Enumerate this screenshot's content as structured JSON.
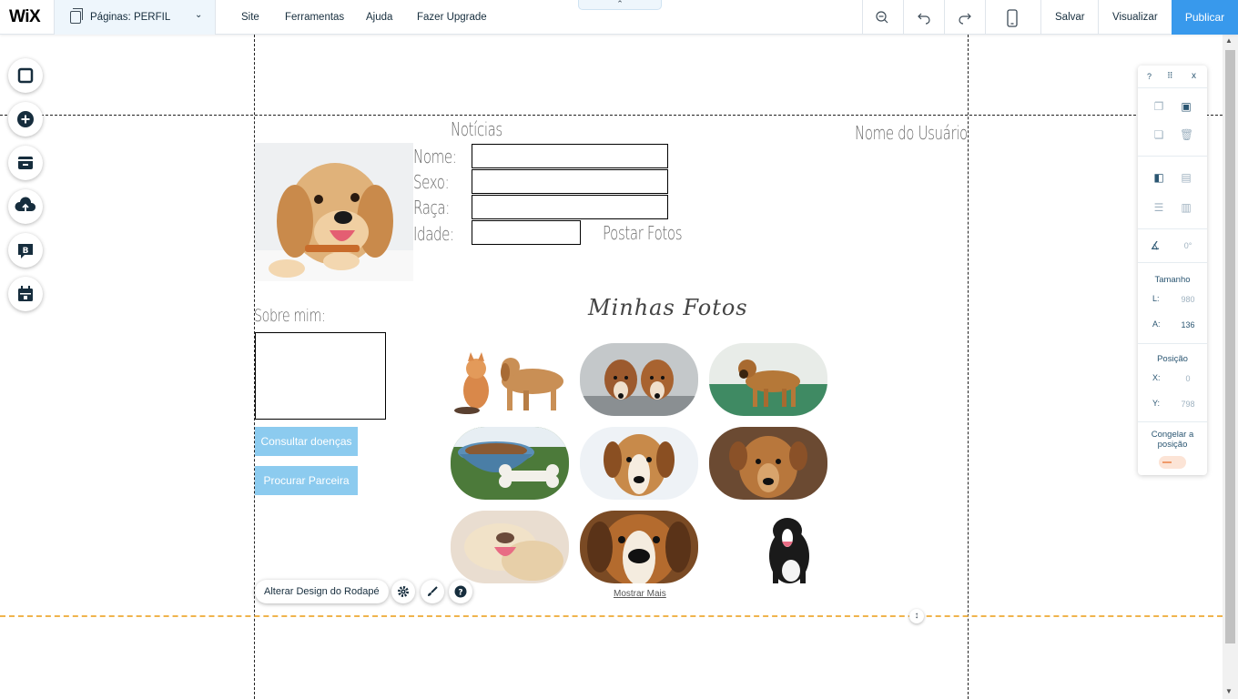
{
  "topbar": {
    "logo": "WiX",
    "pages_label": "Páginas: PERFIL",
    "menu": [
      "Site",
      "Ferramentas",
      "Ajuda",
      "Fazer Upgrade"
    ],
    "collapse_glyph": "⌃",
    "save": "Salvar",
    "preview": "Visualizar",
    "publish": "Publicar",
    "icons": [
      "zoom-out-icon",
      "undo-icon",
      "redo-icon",
      "mobile-icon"
    ]
  },
  "left_toolbar": [
    "background-icon",
    "add-icon",
    "app-market-icon",
    "upload-icon",
    "blog-icon",
    "bookings-icon"
  ],
  "site": {
    "news_title": "Notícias",
    "user_name": "Nome do Usuário",
    "form_labels": [
      "Nome:",
      "Sexo:",
      "Raça:",
      "Idade:"
    ],
    "post_photos": "Postar Fotos",
    "about_me": "Sobre mim:",
    "gallery_title": "Minhas Fotos",
    "buttons": [
      "Consultar doenças",
      "Procurar Parceira"
    ],
    "show_more": "Mostrar Mais",
    "photos": [
      "kitten-and-puppy",
      "two-dachshunds",
      "brown-dog-on-grass",
      "dog-bowl-and-bone",
      "hound-portrait",
      "brown-dog-portrait",
      "sleeping-puppy",
      "beagle-closeup",
      "border-collie"
    ]
  },
  "footer_controls": {
    "change_design": "Alterar Design do Rodapé"
  },
  "inspector": {
    "help": "?",
    "close": "x",
    "angle": "0°",
    "size_title": "Tamanho",
    "width_key": "L:",
    "width_val": "980",
    "height_key": "A:",
    "height_val": "136",
    "position_title": "Posição",
    "x_key": "X:",
    "x_val": "0",
    "y_key": "Y:",
    "y_val": "798",
    "freeze_label": "Congelar a posição"
  },
  "colors": {
    "accent": "#3899ec",
    "site_button": "#8ccbef",
    "footer_guide": "#f0b44d"
  }
}
